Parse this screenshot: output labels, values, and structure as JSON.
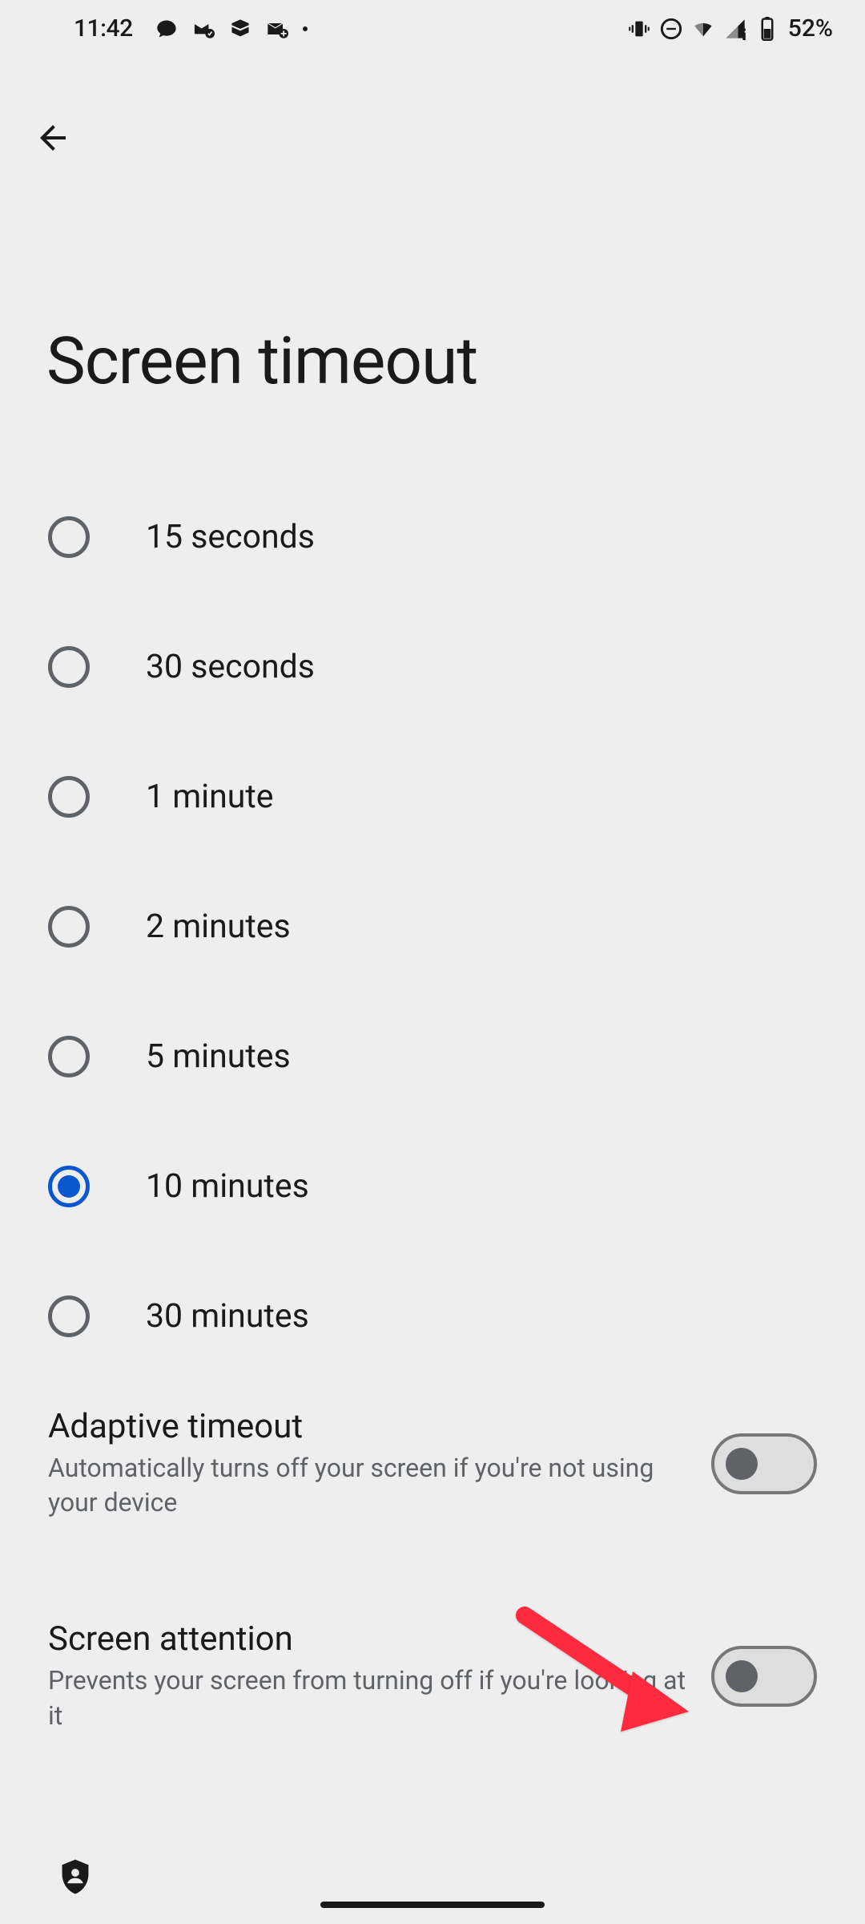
{
  "status": {
    "time": "11:42",
    "battery": "52%"
  },
  "page": {
    "title": "Screen timeout"
  },
  "options": [
    {
      "label": "15 seconds",
      "selected": false
    },
    {
      "label": "30 seconds",
      "selected": false
    },
    {
      "label": "1 minute",
      "selected": false
    },
    {
      "label": "2 minutes",
      "selected": false
    },
    {
      "label": "5 minutes",
      "selected": false
    },
    {
      "label": "10 minutes",
      "selected": true
    },
    {
      "label": "30 minutes",
      "selected": false
    }
  ],
  "toggles": {
    "adaptive": {
      "title": "Adaptive timeout",
      "desc": "Automatically turns off your screen if you're not using your device",
      "on": false
    },
    "attention": {
      "title": "Screen attention",
      "desc": "Prevents your screen from turning off if you're looking at it",
      "on": false
    }
  }
}
